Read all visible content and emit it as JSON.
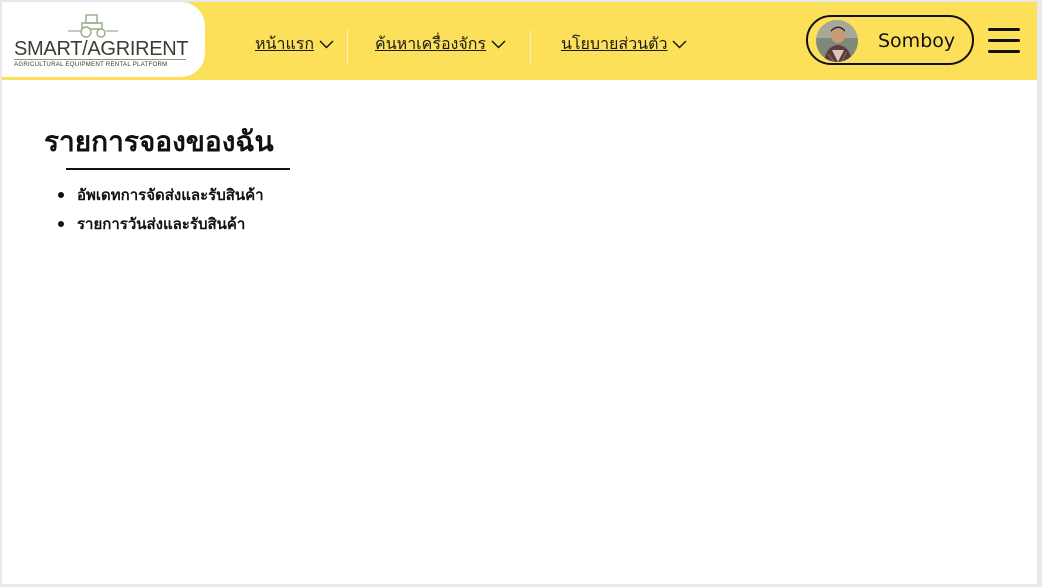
{
  "brand": {
    "name": "SMART/AGRIRENT",
    "tagline": "AGRICULTURAL EQUIPMENT RENTAL PLATFORM",
    "logo_icon": "tractor-icon"
  },
  "nav": {
    "items": [
      {
        "label": "หน้าแรก",
        "icon": "chevron-down-icon"
      },
      {
        "label": "ค้นหาเครื่องจักร",
        "icon": "chevron-down-icon"
      },
      {
        "label": "นโยบายส่วนตัว",
        "icon": "chevron-down-icon"
      }
    ]
  },
  "user": {
    "name": "Somboy",
    "avatar_icon": "avatar"
  },
  "menu": {
    "icon": "hamburger-menu-icon"
  },
  "main": {
    "title": "รายการจองของฉัน",
    "links": [
      "อัพเดทการจัดส่งและรับสินค้า",
      "รายการวันส่งและรับสินค้า"
    ]
  },
  "colors": {
    "header_bg": "#fde05a",
    "logo_bg": "#ffffff",
    "text": "#111111"
  }
}
